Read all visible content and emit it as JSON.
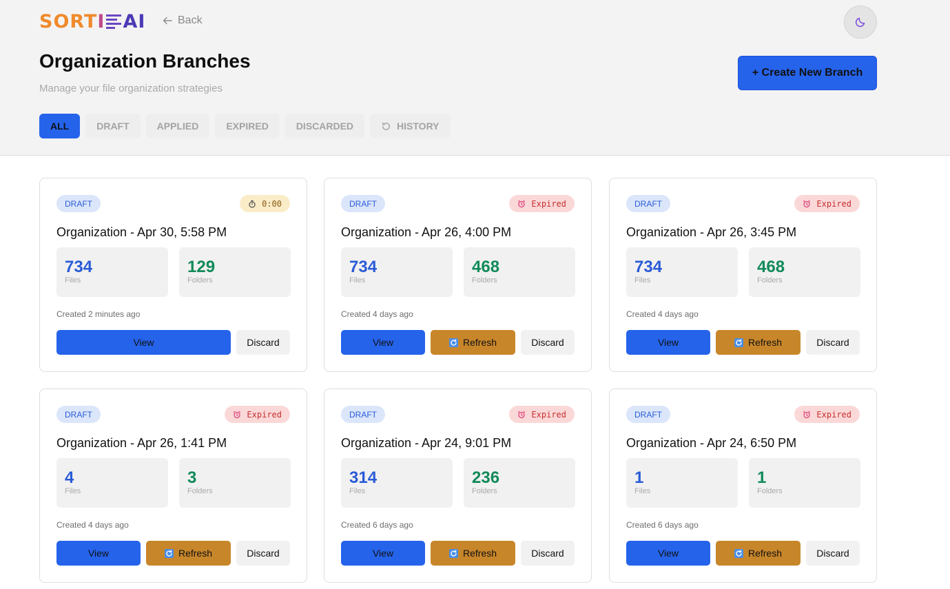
{
  "app": {
    "logo_parts": [
      "SORT",
      "I",
      "I",
      "AI"
    ],
    "back_label": "Back"
  },
  "page": {
    "title": "Organization Branches",
    "subtitle": "Manage your file organization strategies",
    "create_button": "+ Create New Branch"
  },
  "tabs": [
    {
      "label": "ALL",
      "active": true
    },
    {
      "label": "DRAFT",
      "active": false
    },
    {
      "label": "APPLIED",
      "active": false
    },
    {
      "label": "EXPIRED",
      "active": false
    },
    {
      "label": "DISCARDED",
      "active": false
    },
    {
      "label": "HISTORY",
      "active": false,
      "icon": "history-icon"
    }
  ],
  "labels": {
    "files": "Files",
    "folders": "Folders",
    "view": "View",
    "refresh": "Refresh",
    "discard": "Discard"
  },
  "cards": [
    {
      "status": "DRAFT",
      "timer": "0:00",
      "expired": false,
      "title": "Organization - Apr 30, 5:58 PM",
      "files": "734",
      "folders": "129",
      "created": "Created 2 minutes ago",
      "show_refresh": false
    },
    {
      "status": "DRAFT",
      "timer": "Expired",
      "expired": true,
      "title": "Organization - Apr 26, 4:00 PM",
      "files": "734",
      "folders": "468",
      "created": "Created 4 days ago",
      "show_refresh": true
    },
    {
      "status": "DRAFT",
      "timer": "Expired",
      "expired": true,
      "title": "Organization - Apr 26, 3:45 PM",
      "files": "734",
      "folders": "468",
      "created": "Created 4 days ago",
      "show_refresh": true
    },
    {
      "status": "DRAFT",
      "timer": "Expired",
      "expired": true,
      "title": "Organization - Apr 26, 1:41 PM",
      "files": "4",
      "folders": "3",
      "created": "Created 4 days ago",
      "show_refresh": true
    },
    {
      "status": "DRAFT",
      "timer": "Expired",
      "expired": true,
      "title": "Organization - Apr 24, 9:01 PM",
      "files": "314",
      "folders": "236",
      "created": "Created 6 days ago",
      "show_refresh": true
    },
    {
      "status": "DRAFT",
      "timer": "Expired",
      "expired": true,
      "title": "Organization - Apr 24, 6:50 PM",
      "files": "1",
      "folders": "1",
      "created": "Created 6 days ago",
      "show_refresh": true
    }
  ],
  "colors": {
    "primary": "#2563eb",
    "refresh": "#c8862a",
    "files_number": "#2a5bd7",
    "folders_number": "#118a5a",
    "expired_badge": "#fbd8d8",
    "timer_badge": "#fbecc8"
  }
}
